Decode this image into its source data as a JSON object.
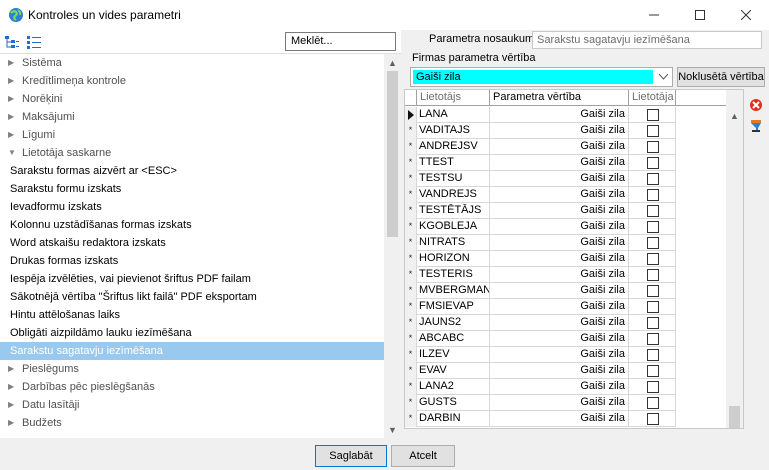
{
  "window": {
    "title": "Kontroles un vides parametri",
    "icon": "globe-app-icon"
  },
  "left": {
    "search_placeholder": "Meklēt...",
    "tree": [
      {
        "label": "Sistēma",
        "type": "category",
        "state": "collapsed"
      },
      {
        "label": "Kredītlimeņa kontrole",
        "type": "category",
        "state": "collapsed"
      },
      {
        "label": "Norēķini",
        "type": "category",
        "state": "collapsed"
      },
      {
        "label": "Maksājumi",
        "type": "category",
        "state": "collapsed"
      },
      {
        "label": "Līgumi",
        "type": "category",
        "state": "collapsed"
      },
      {
        "label": "Lietotāja saskarne",
        "type": "category",
        "state": "expanded"
      },
      {
        "label": "Sarakstu formas aizvērt ar <ESC>",
        "type": "leaf"
      },
      {
        "label": "Sarakstu formu izskats",
        "type": "leaf"
      },
      {
        "label": "Ievadformu izskats",
        "type": "leaf"
      },
      {
        "label": "Kolonnu uzstādīšanas formas izskats",
        "type": "leaf"
      },
      {
        "label": "Word atskaišu redaktora izskats",
        "type": "leaf"
      },
      {
        "label": "Drukas formas izskats",
        "type": "leaf"
      },
      {
        "label": "Iespēja izvēlēties, vai pievienot šriftus PDF failam",
        "type": "leaf"
      },
      {
        "label": "Sākotnējā vērtība \"Šriftus likt failā\" PDF eksportam",
        "type": "leaf"
      },
      {
        "label": "Hintu attēlošanas laiks",
        "type": "leaf"
      },
      {
        "label": "Obligāti aizpildāmo lauku iezīmēšana",
        "type": "leaf"
      },
      {
        "label": "Sarakstu sagatavju iezīmēšana",
        "type": "leaf",
        "selected": true
      },
      {
        "label": "Pieslēgums",
        "type": "category",
        "state": "collapsed"
      },
      {
        "label": "Darbības pēc pieslēgšanās",
        "type": "category",
        "state": "collapsed"
      },
      {
        "label": "Datu lasītāji",
        "type": "category",
        "state": "collapsed"
      },
      {
        "label": "Budžets",
        "type": "category",
        "state": "collapsed"
      }
    ]
  },
  "right": {
    "param_name_label": "Parametra nosaukums:",
    "param_name_value": "Sarakstu sagatavju iezīmēšana",
    "firm_value_label": "Firmas parametra vērtība",
    "firm_value": "Gaiši zila",
    "firm_value_color": "#00ffff",
    "reset_button": "Noklusētā vērtība",
    "grid": {
      "headers": [
        "Lietotājs",
        "Parametra vērtība",
        "Lietotāja"
      ],
      "rows": [
        {
          "user": "LANA",
          "value": "Gaiši zila",
          "current": true
        },
        {
          "user": "VADITAJS",
          "value": "Gaiši zila"
        },
        {
          "user": "ANDREJSV",
          "value": "Gaiši zila"
        },
        {
          "user": "TTEST",
          "value": "Gaiši zila"
        },
        {
          "user": "TESTSU",
          "value": "Gaiši zila"
        },
        {
          "user": "VANDREJS",
          "value": "Gaiši zila"
        },
        {
          "user": "TESTĒTĀJS",
          "value": "Gaiši zila"
        },
        {
          "user": "KGOBLEJA",
          "value": "Gaiši zila"
        },
        {
          "user": "NITRATS",
          "value": "Gaiši zila"
        },
        {
          "user": "HORIZON",
          "value": "Gaiši zila"
        },
        {
          "user": "TESTERIS",
          "value": "Gaiši zila"
        },
        {
          "user": "MVBERGMANE",
          "value": "Gaiši zila"
        },
        {
          "user": "FMSIEVAP",
          "value": "Gaiši zila"
        },
        {
          "user": "JAUNS2",
          "value": "Gaiši zila"
        },
        {
          "user": "ABCABC",
          "value": "Gaiši zila"
        },
        {
          "user": "ILZEV",
          "value": "Gaiši zila"
        },
        {
          "user": "EVAV",
          "value": "Gaiši zila"
        },
        {
          "user": "LANA2",
          "value": "Gaiši zila"
        },
        {
          "user": "GUSTS",
          "value": "Gaiši zila"
        },
        {
          "user": "DARBIN",
          "value": "Gaiši zila"
        }
      ]
    }
  },
  "footer": {
    "save": "Saglabāt",
    "cancel": "Atcelt"
  }
}
